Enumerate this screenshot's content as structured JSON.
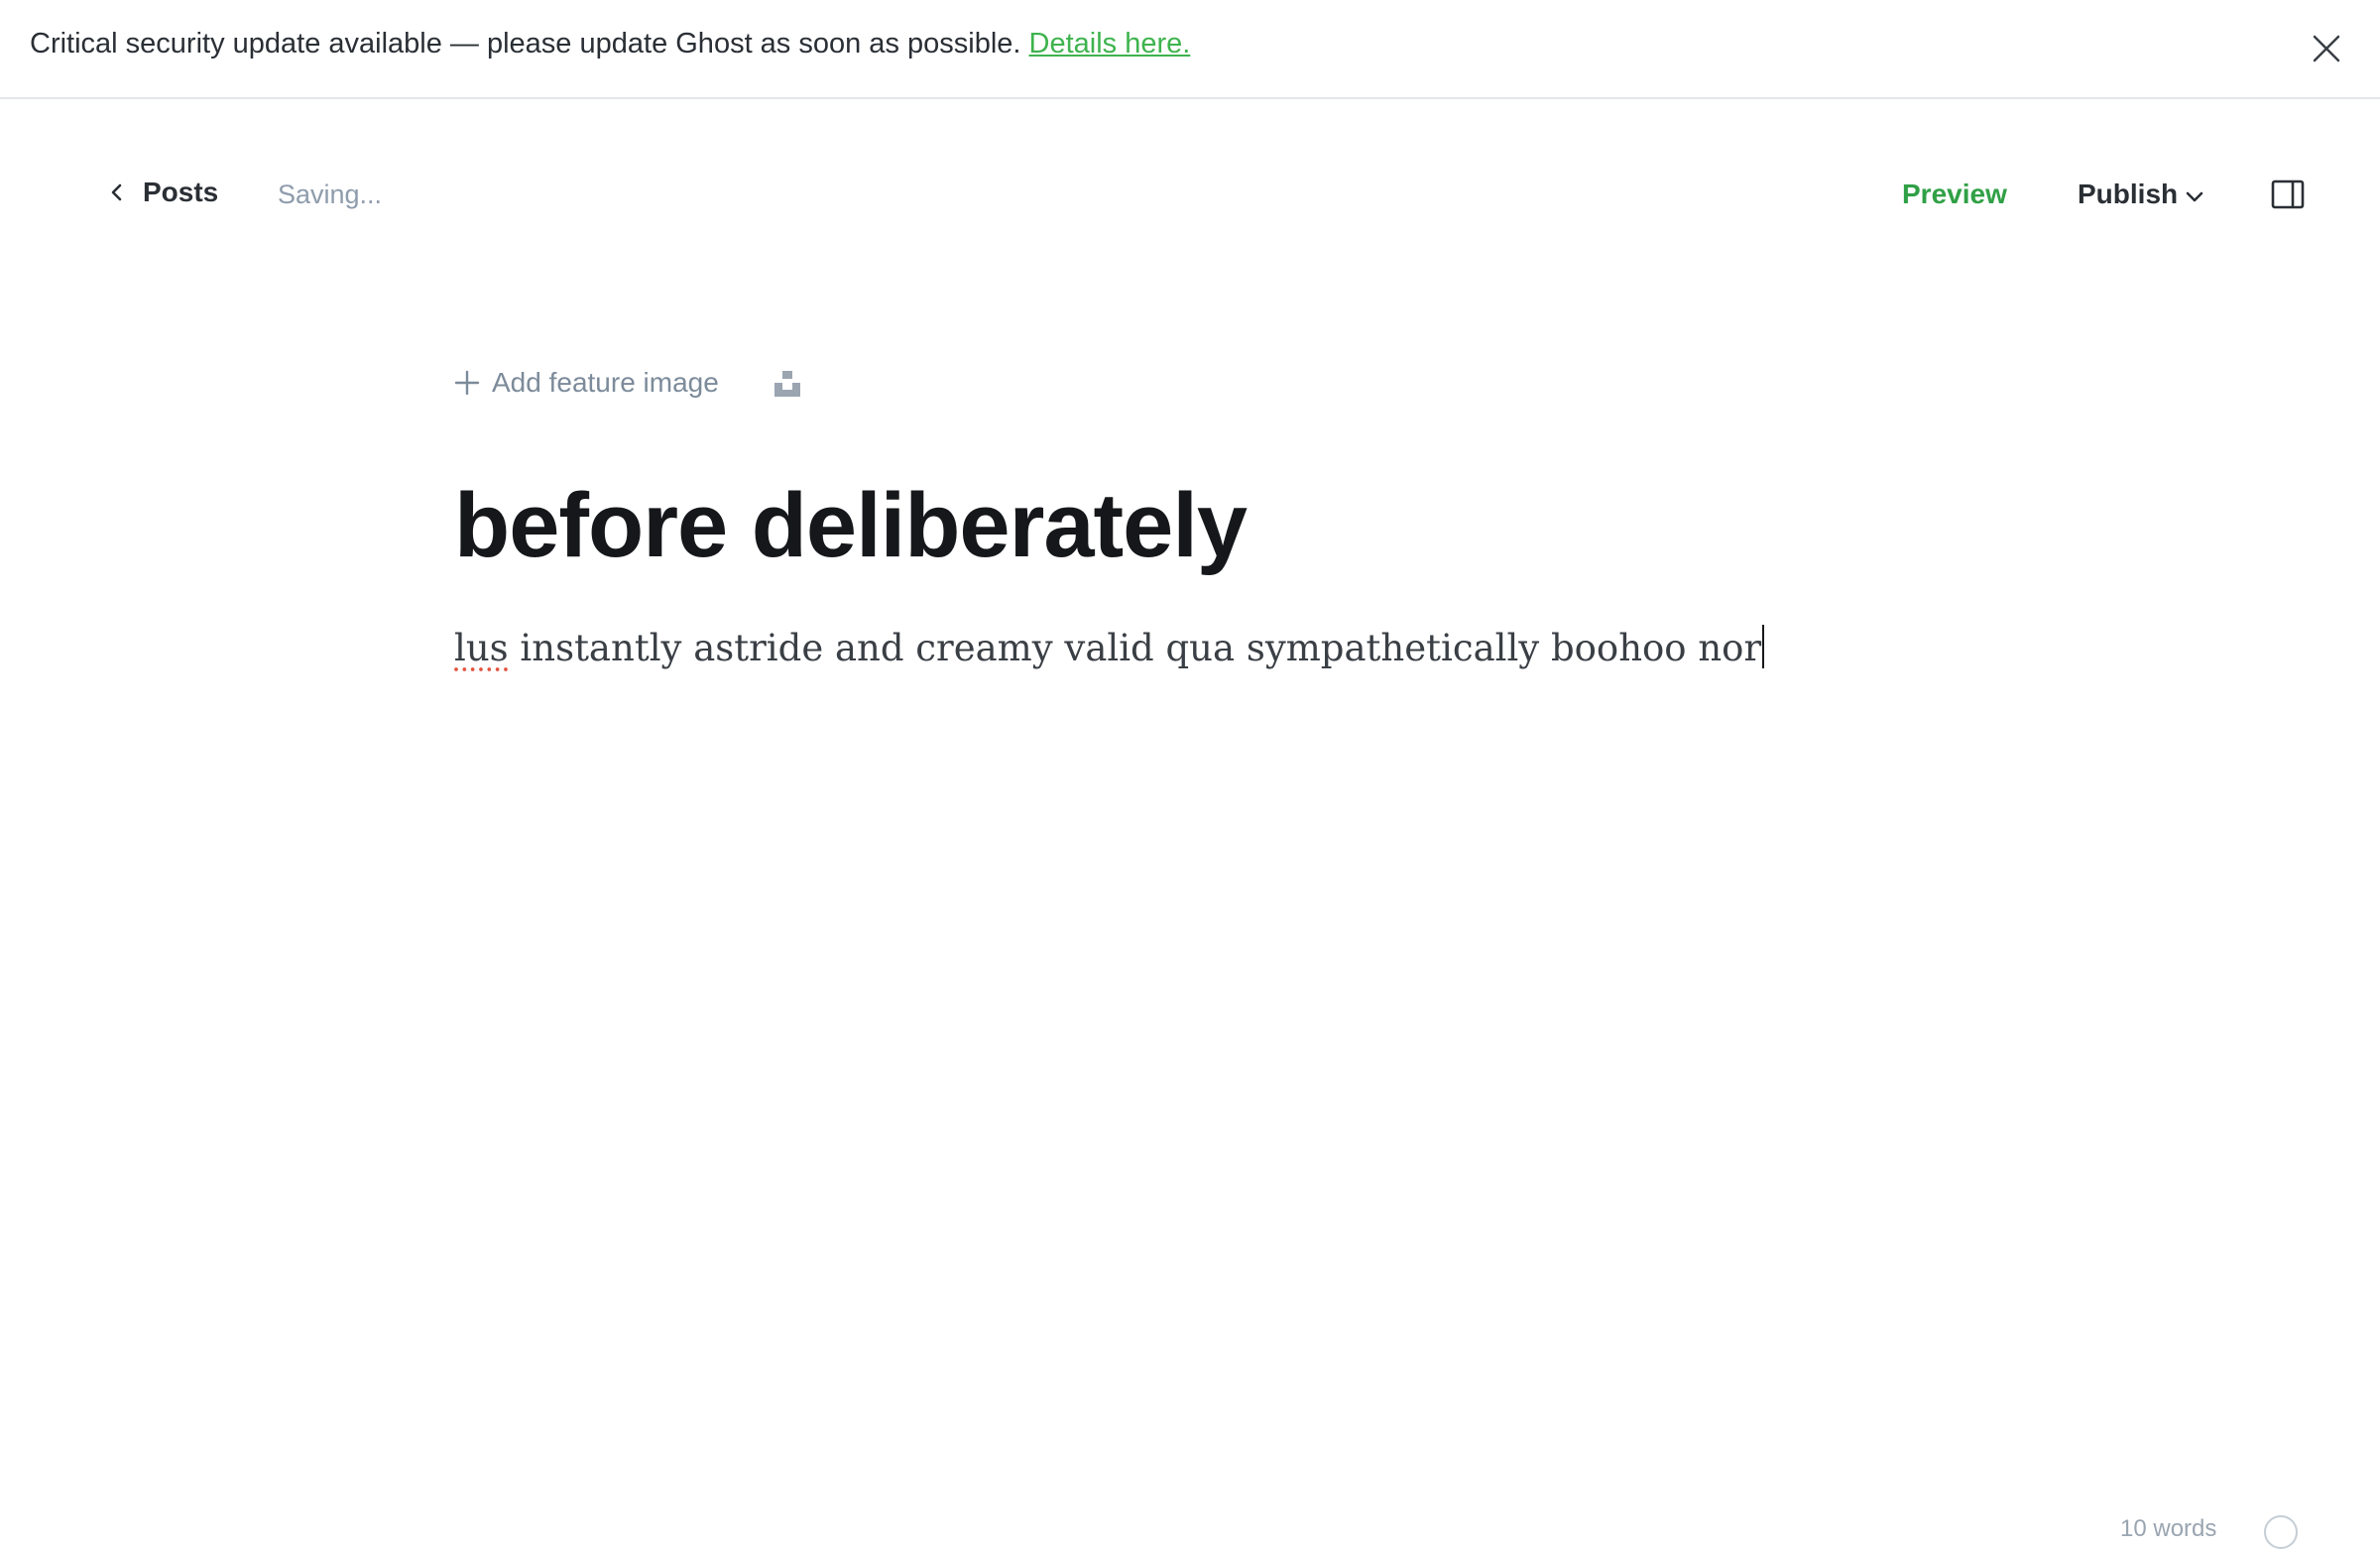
{
  "banner": {
    "message": "Critical security update available — please update Ghost as soon as possible.",
    "link_label": "Details here.",
    "close_icon": "close-icon"
  },
  "header": {
    "back_label": "Posts",
    "status": "Saving...",
    "preview_label": "Preview",
    "publish_label": "Publish"
  },
  "editor": {
    "feature_image_label": "Add feature image",
    "title": "before deliberately",
    "body_first_word": "lus",
    "body_rest": " instantly astride and creamy valid qua sympathetically boohoo nor"
  },
  "footer": {
    "word_count": "10 words"
  },
  "colors": {
    "accent": "#30a046",
    "text": "#15171a",
    "muted": "#8e9cac"
  }
}
